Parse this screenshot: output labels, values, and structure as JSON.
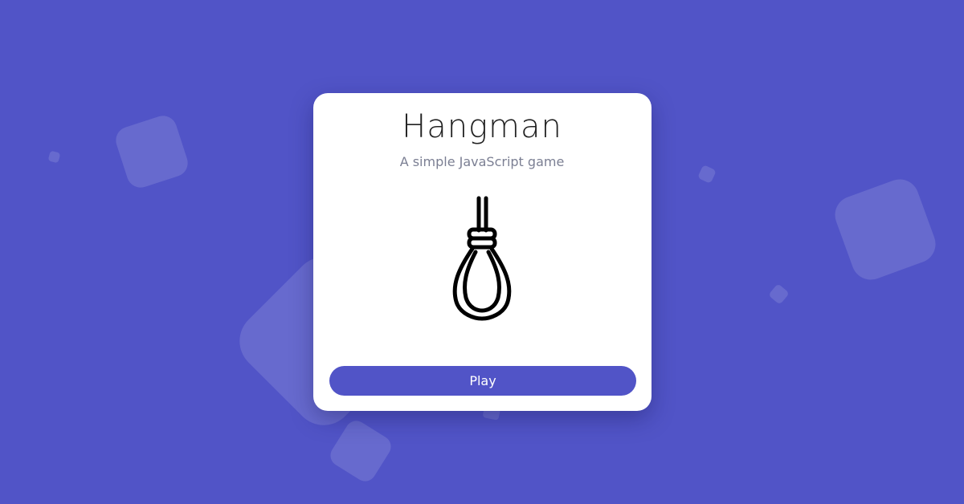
{
  "game": {
    "title": "Hangman",
    "subtitle": "A simple JavaScript game",
    "play_label": "Play"
  },
  "colors": {
    "background": "#5154c7",
    "card": "#ffffff",
    "button": "#5154c7",
    "button_text": "#ffffff",
    "title_text": "#222222",
    "subtitle_text": "#7b7f93"
  },
  "icons": {
    "illustration": "noose-icon"
  }
}
